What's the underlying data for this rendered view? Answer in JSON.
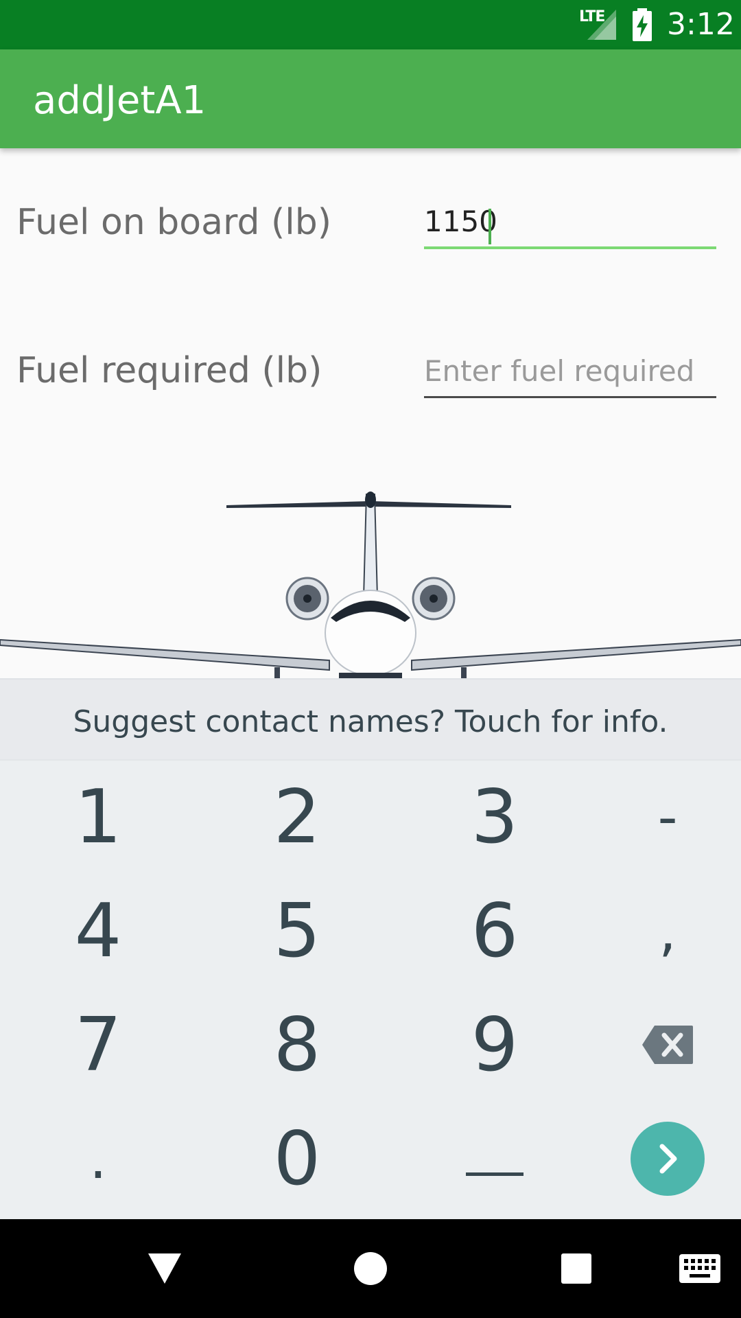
{
  "status_bar": {
    "network": "LTE",
    "time": "3:12",
    "background": "#087F23"
  },
  "app_bar": {
    "title": "addJetA1",
    "background": "#4CAF50"
  },
  "form": {
    "fuel_on_board": {
      "label": "Fuel on board (lb)",
      "value": "1150",
      "placeholder": ""
    },
    "fuel_required": {
      "label": "Fuel required (lb)",
      "value": "",
      "placeholder": "Enter fuel required"
    }
  },
  "image": {
    "icon": "private-jet-front-view"
  },
  "keyboard": {
    "suggestion": "Suggest contact names? Touch for info.",
    "keys": {
      "k1": "1",
      "k2": "2",
      "k3": "3",
      "dash": "-",
      "k4": "4",
      "k5": "5",
      "k6": "6",
      "comma": ",",
      "k7": "7",
      "k8": "8",
      "k9": "9",
      "period": ".",
      "k0": "0"
    },
    "icons": {
      "backspace": "backspace-icon",
      "space": "space-bar-icon",
      "next": "next-arrow-icon"
    },
    "accent": "#4DB6AC"
  },
  "nav_bar": {
    "icons": [
      "back-triangle-icon",
      "home-circle-icon",
      "recents-square-icon",
      "keyboard-icon"
    ]
  }
}
